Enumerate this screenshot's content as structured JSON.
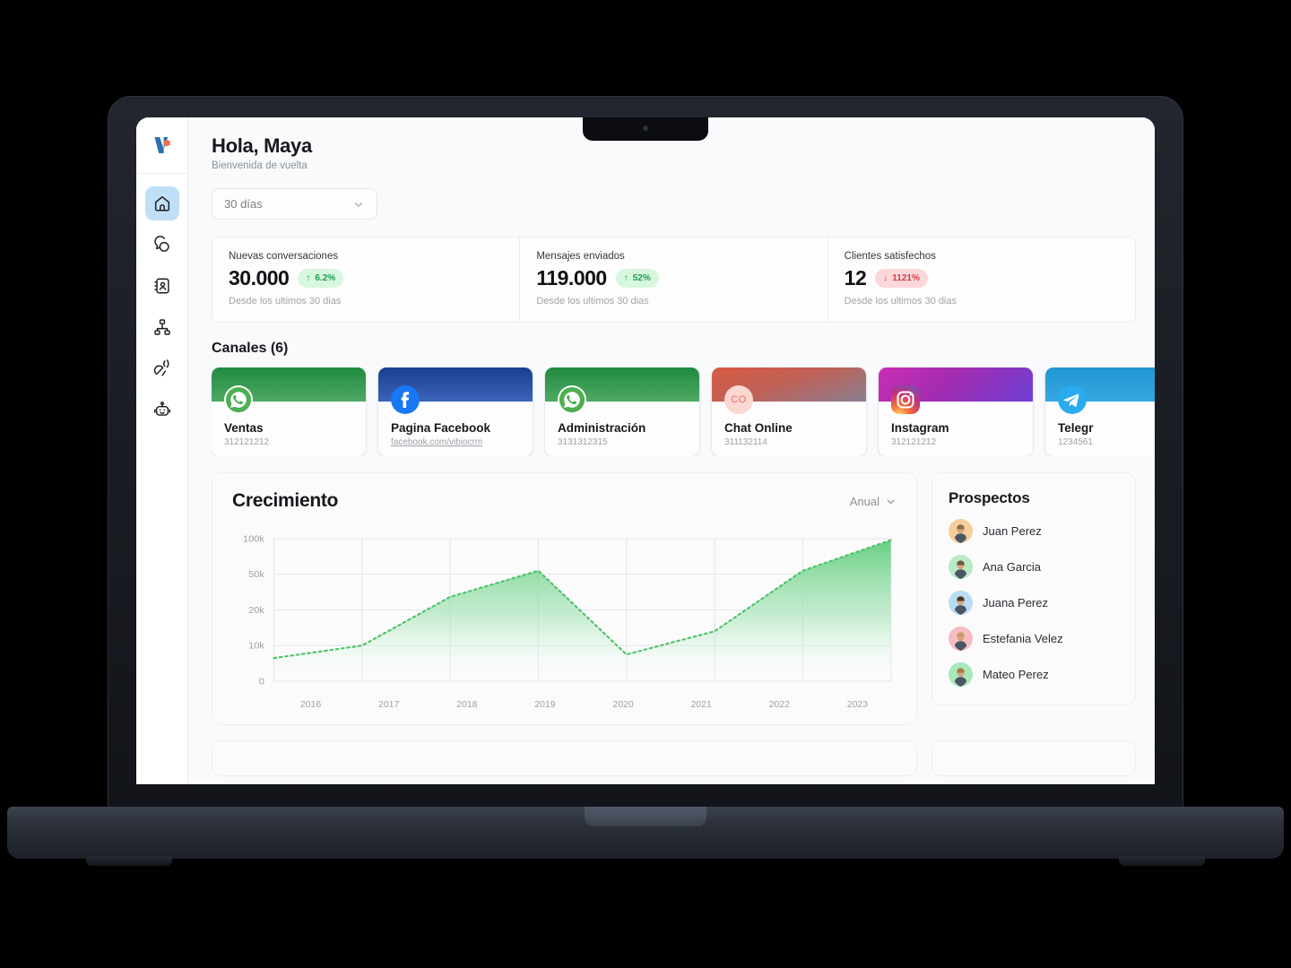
{
  "brand": {
    "logo_name": "vibio-logo",
    "logo_color": "#2d6fad",
    "accent_dot_color": "#f2714e"
  },
  "sidebar": {
    "items": [
      {
        "icon": "home-icon",
        "name": "inicio",
        "active": true
      },
      {
        "icon": "chat-bubbles-icon",
        "name": "conversaciones",
        "active": false
      },
      {
        "icon": "contacts-icon",
        "name": "contactos",
        "active": false
      },
      {
        "icon": "org-chart-icon",
        "name": "flujos",
        "active": false
      },
      {
        "icon": "broadcast-icon",
        "name": "campanas",
        "active": false
      },
      {
        "icon": "robot-icon",
        "name": "bots",
        "active": false
      }
    ]
  },
  "header": {
    "greeting": "Hola, Maya",
    "subtitle": "Bienvenida de vuelta"
  },
  "range_filter": {
    "value": "30 días",
    "icon": "chevron-down-icon"
  },
  "stats": [
    {
      "label": "Nuevas conversaciones",
      "value": "30.000",
      "delta": "6.2%",
      "direction": "up",
      "arrow": "↑",
      "sub": "Desde los ultimos 30 dias"
    },
    {
      "label": "Mensajes enviados",
      "value": "119.000",
      "delta": "52%",
      "direction": "up",
      "arrow": "↑",
      "sub": "Desde los ultimos 30 dias"
    },
    {
      "label": "Clientes satisfechos",
      "value": "12",
      "delta": "1121%",
      "direction": "down",
      "arrow": "↓",
      "sub": "Desde los ultimos 30 dias"
    }
  ],
  "channels_section": {
    "title": "Canales (6)"
  },
  "channels": [
    {
      "name": "Ventas",
      "sub": "312121212",
      "sub_link_part": "",
      "icon": "whatsapp-icon",
      "banner_from": "#1f8a3f",
      "banner_to": "#4faa63"
    },
    {
      "name": "Pagina Facebook",
      "sub": "",
      "sub_link_part": "facebook.com/vibiocrm",
      "icon": "facebook-icon",
      "banner_from": "#1b3f8f",
      "banner_to": "#3b63b8"
    },
    {
      "name": "Administración",
      "sub": "3131312315",
      "sub_link_part": "",
      "icon": "whatsapp-icon",
      "banner_from": "#1f8a3f",
      "banner_to": "#4faa63"
    },
    {
      "name": "Chat Online",
      "sub": "311132114",
      "sub_link_part": "",
      "icon": "co-monogram-icon",
      "banner_from": "#d85a43",
      "banner_to": "#8a7f92"
    },
    {
      "name": "Instagram",
      "sub": "312121212",
      "sub_link_part": "",
      "icon": "instagram-icon",
      "banner_from": "#a32cb0",
      "banner_to": "#7b3fd4"
    },
    {
      "name": "Telegr",
      "sub": "1234561",
      "sub_link_part": "",
      "icon": "telegram-icon",
      "banner_from": "#2196d3",
      "banner_to": "#36a8e0"
    }
  ],
  "growth": {
    "title": "Crecimiento",
    "range": "Anual",
    "range_icon": "chevron-down-icon"
  },
  "chart_data": {
    "type": "area",
    "title": "Crecimiento",
    "xlabel": "",
    "ylabel": "",
    "x": [
      "2016",
      "2017",
      "2018",
      "2019",
      "2020",
      "2021",
      "2022",
      "2023"
    ],
    "categories": [
      "2016",
      "2017",
      "2018",
      "2019",
      "2020",
      "2021",
      "2022",
      "2023"
    ],
    "values": [
      6500,
      10000,
      31000,
      55000,
      7500,
      14000,
      55000,
      98000
    ],
    "series": [
      {
        "name": "Crecimiento",
        "values": [
          6500,
          10000,
          31000,
          55000,
          7500,
          14000,
          55000,
          98000
        ]
      }
    ],
    "ytick_labels": [
      "0",
      "10k",
      "20k",
      "50k",
      "100k"
    ],
    "ytick_values": [
      0,
      10000,
      20000,
      50000,
      100000
    ],
    "ylim": [
      0,
      100000
    ],
    "y_scale": "nonlinear-ticks",
    "grid": true,
    "legend": "none",
    "line_style": "dotted",
    "line_color": "#4cc46a",
    "fill_from": "#6fd389",
    "fill_to": "#ffffff"
  },
  "prospects": {
    "title": "Prospectos",
    "items": [
      {
        "name": "Juan Perez",
        "avatar_bg": "#f3cf9b"
      },
      {
        "name": "Ana Garcia",
        "avatar_bg": "#b9eac4"
      },
      {
        "name": "Juana Perez",
        "avatar_bg": "#b8ddf2"
      },
      {
        "name": "Estefania Velez",
        "avatar_bg": "#f6bcc4"
      },
      {
        "name": "Mateo Perez",
        "avatar_bg": "#a9e8b9"
      }
    ]
  }
}
